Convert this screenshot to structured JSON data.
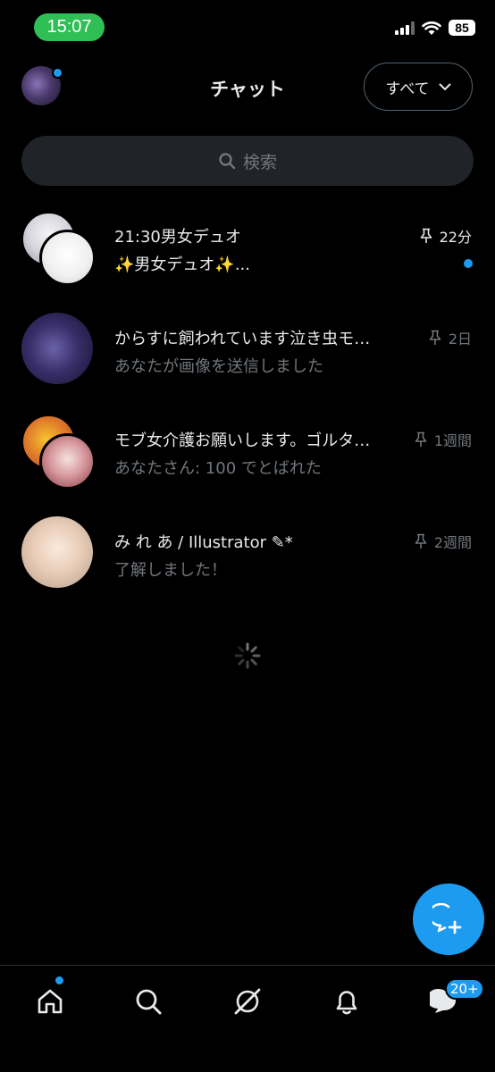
{
  "status_bar": {
    "time": "15:07",
    "battery": "85"
  },
  "header": {
    "title": "チャット",
    "filter_label": "すべて"
  },
  "search": {
    "placeholder": "検索"
  },
  "chats": [
    {
      "name": "21:30男女デュオ",
      "message": "✨男女デュオ✨...",
      "time": "22分",
      "unread": true
    },
    {
      "name": "からすに飼われています泣き虫モ…",
      "message": "あなたが画像を送信しました",
      "time": "2日",
      "unread": false
    },
    {
      "name": "モブ女介護お願いします。ゴルタ…",
      "message": "あなたさん: 100 でとばれた",
      "time": "1週間",
      "unread": false
    },
    {
      "name": "み れ あ / Illustrator ✎*",
      "message": "了解しました！",
      "time": "2週間",
      "unread": false
    }
  ],
  "bottom_nav": {
    "messages_badge": "20+"
  },
  "colors": {
    "accent": "#1d9bf0",
    "background": "#000000",
    "muted": "#71767b"
  }
}
